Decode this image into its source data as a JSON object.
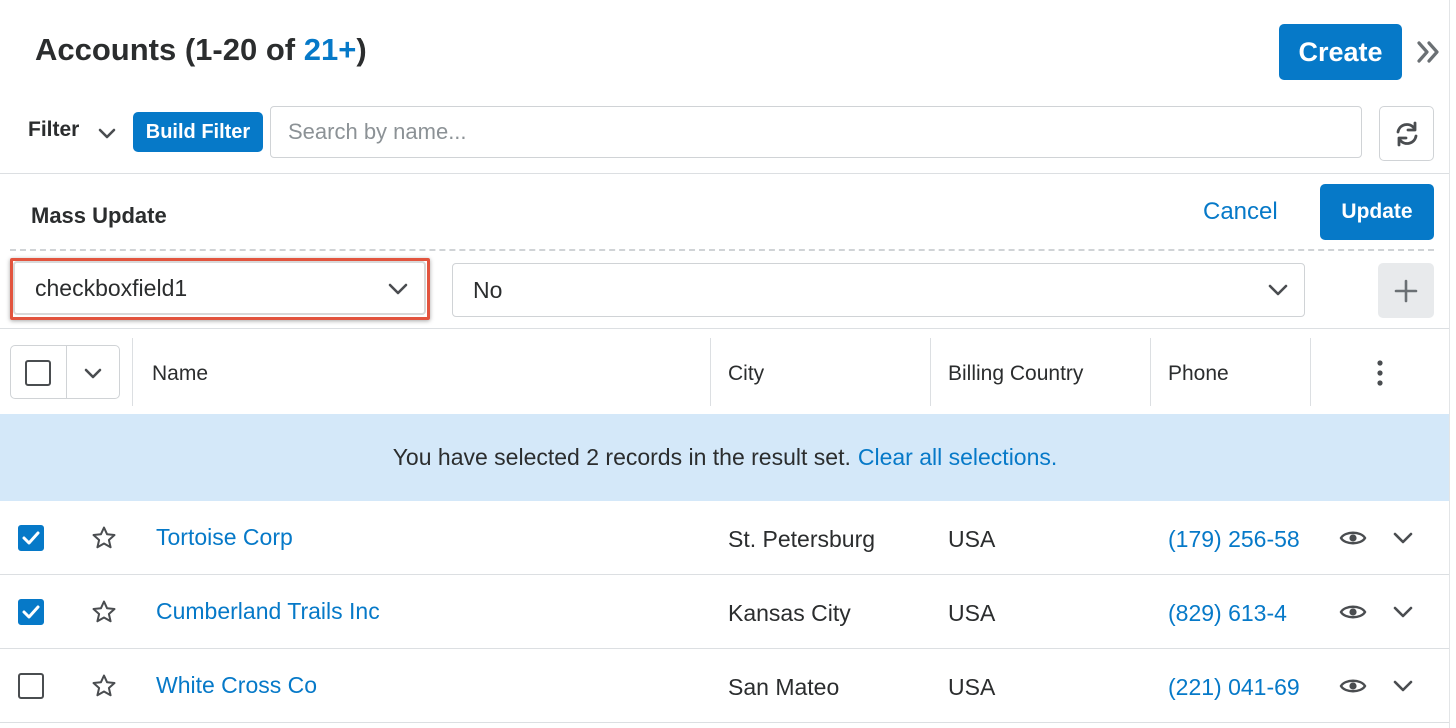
{
  "header": {
    "title_prefix": "Accounts (1-20 of ",
    "title_count": "21+",
    "title_suffix": ")",
    "create_label": "Create"
  },
  "filter": {
    "label": "Filter",
    "build_filter_label": "Build Filter",
    "search_placeholder": "Search by name..."
  },
  "mass_update": {
    "title": "Mass Update",
    "cancel_label": "Cancel",
    "update_label": "Update",
    "field_value": "checkboxfield1",
    "value_value": "No"
  },
  "table": {
    "columns": [
      "Name",
      "City",
      "Billing Country",
      "Phone"
    ],
    "banner_text": "You have selected 2 records in the result set.",
    "banner_link": "Clear all selections.",
    "rows": [
      {
        "checked": true,
        "name": "Tortoise Corp",
        "city": "St. Petersburg",
        "country": "USA",
        "phone": "(179) 256-58"
      },
      {
        "checked": true,
        "name": "Cumberland Trails Inc",
        "city": "Kansas City",
        "country": "USA",
        "phone": "(829) 613-4"
      },
      {
        "checked": false,
        "name": "White Cross Co",
        "city": "San Mateo",
        "country": "USA",
        "phone": "(221) 041-69"
      }
    ]
  },
  "icons": {
    "collapse": "double-chevron-right-icon",
    "refresh": "refresh-icon",
    "add": "plus-icon",
    "more": "kebab-icon",
    "favorite": "star-icon",
    "preview": "eye-icon",
    "expand": "chevron-down-icon"
  },
  "colors": {
    "accent": "#0679c8",
    "banner": "#d4e8f9",
    "highlight": "#e2543e"
  }
}
